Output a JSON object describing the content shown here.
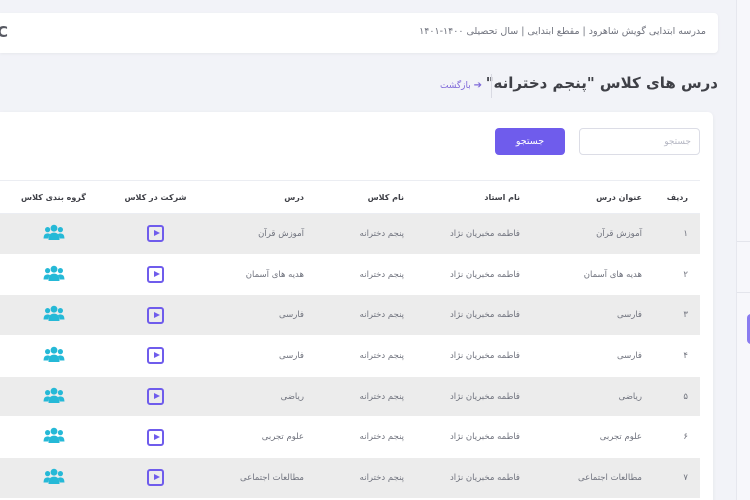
{
  "header": {
    "school_info": "مدرسه ابتدایی گویش شاهرود | مقطع ابتدایی | سال تحصیلی ۱۴۰۰-۱۴۰۱",
    "left_glyph": "C"
  },
  "page": {
    "title": "درس های کلاس \"پنجم دخترانه\"",
    "back_label": "بازگشت",
    "back_arrow": "➔"
  },
  "search": {
    "placeholder": "جستجو",
    "value": "",
    "button_label": "جستجو"
  },
  "table": {
    "columns": [
      "ردیف",
      "عنوان درس",
      "نام استاد",
      "نام کلاس",
      "درس",
      "شرکت در کلاس",
      "گروه بندی کلاس"
    ],
    "rows": [
      {
        "index": "۱",
        "title": "آموزش قرآن",
        "teacher": "فاطمه مخبریان نژاد",
        "class": "پنجم دخترانه",
        "lesson": "آموزش قرآن"
      },
      {
        "index": "۲",
        "title": "هدیه های آسمان",
        "teacher": "فاطمه مخبریان نژاد",
        "class": "پنجم دخترانه",
        "lesson": "هدیه های آسمان"
      },
      {
        "index": "۳",
        "title": "فارسی",
        "teacher": "فاطمه مخبریان نژاد",
        "class": "پنجم دخترانه",
        "lesson": "فارسی"
      },
      {
        "index": "۴",
        "title": "فارسی",
        "teacher": "فاطمه مخبریان نژاد",
        "class": "پنجم دخترانه",
        "lesson": "فارسی"
      },
      {
        "index": "۵",
        "title": "ریاضی",
        "teacher": "فاطمه مخبریان نژاد",
        "class": "پنجم دخترانه",
        "lesson": "ریاضی"
      },
      {
        "index": "۶",
        "title": "علوم تجربی",
        "teacher": "فاطمه مخبریان نژاد",
        "class": "پنجم دخترانه",
        "lesson": "علوم تجربی"
      },
      {
        "index": "۷",
        "title": "مطالعات اجتماعی",
        "teacher": "فاطمه مخبریان نژاد",
        "class": "پنجم دخترانه",
        "lesson": "مطالعات اجتماعی"
      }
    ]
  },
  "icons": {
    "join_class": "play-icon",
    "class_group": "users-group-icon",
    "back": "arrow-right-icon"
  },
  "colors": {
    "accent": "#6f5cec",
    "group_icon": "#25b9d7",
    "row_stripe": "#ececec"
  }
}
